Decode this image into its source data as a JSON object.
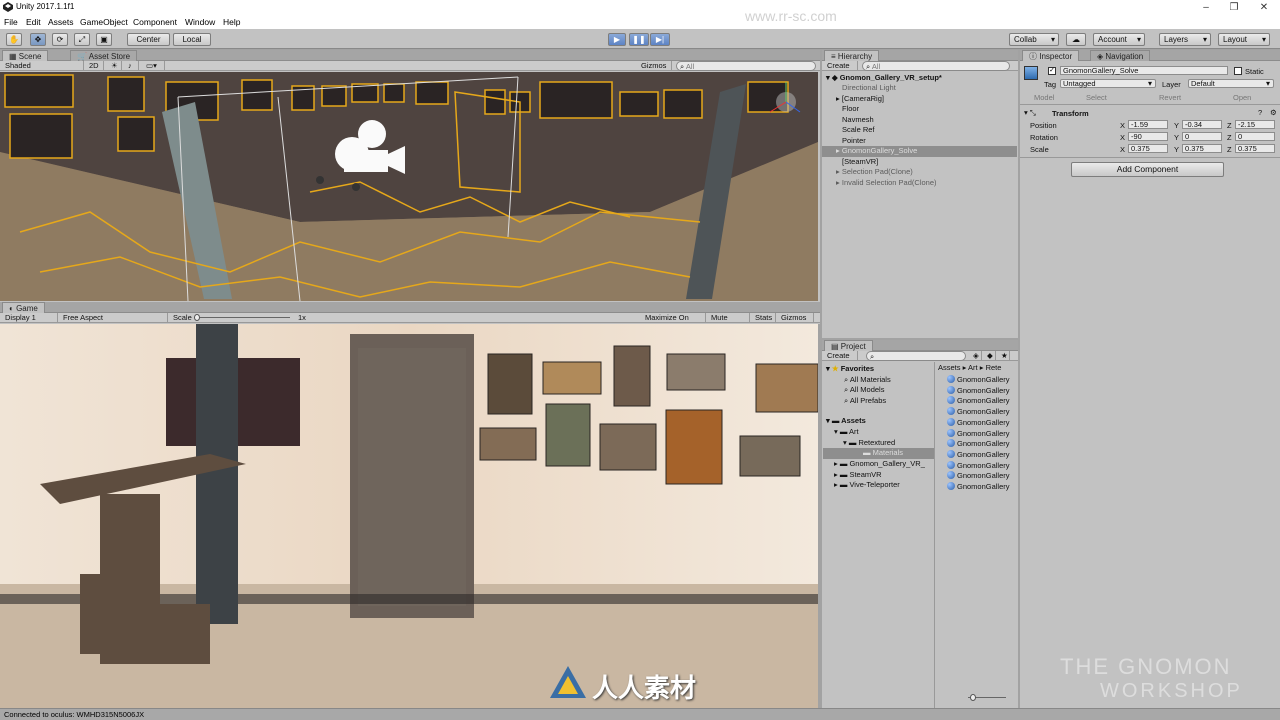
{
  "window": {
    "title": "Unity 2017.1.1f1",
    "min": "–",
    "max": "❐",
    "close": "✕"
  },
  "menu": [
    "File",
    "Edit",
    "Assets",
    "GameObject",
    "Component",
    "Window",
    "Help"
  ],
  "toolbar": {
    "pivot": "Center",
    "space": "Local",
    "collab": "Collab",
    "account": "Account",
    "layers": "Layers",
    "layout": "Layout"
  },
  "scene": {
    "tab_scene": "Scene",
    "tab_store": "Asset Store",
    "shading": "Shaded",
    "mode_2d": "2D",
    "gizmos": "Gizmos",
    "search_placeholder": "All"
  },
  "game": {
    "tab": "Game",
    "display": "Display 1",
    "aspect": "Free Aspect",
    "scale_label": "Scale",
    "scale_value": "1x",
    "maximize": "Maximize On Play",
    "mute": "Mute Audio",
    "stats": "Stats",
    "gizmos": "Gizmos"
  },
  "hierarchy": {
    "tab": "Hierarchy",
    "create": "Create",
    "search_placeholder": "All",
    "scene_name": "Gnomon_Gallery_VR_setup*",
    "items": [
      {
        "label": "Directional Light",
        "state": "gray"
      },
      {
        "label": "[CameraRig]",
        "state": "normal"
      },
      {
        "label": "Floor",
        "state": "normal"
      },
      {
        "label": "Navmesh",
        "state": "normal"
      },
      {
        "label": "Scale Ref",
        "state": "normal"
      },
      {
        "label": "Pointer",
        "state": "normal"
      },
      {
        "label": "GnomonGallery_Solve",
        "state": "selected"
      },
      {
        "label": "[SteamVR]",
        "state": "normal"
      },
      {
        "label": "Selection Pad(Clone)",
        "state": "gray"
      },
      {
        "label": "Invalid Selection Pad(Clone)",
        "state": "gray"
      }
    ]
  },
  "inspector": {
    "tab": "Inspector",
    "tab2": "Navigation",
    "object_name": "GnomonGallery_Solve",
    "static": "Static",
    "tag_label": "Tag",
    "tag_value": "Untagged",
    "layer_label": "Layer",
    "layer_value": "Default",
    "model": "Model",
    "select": "Select",
    "revert": "Revert",
    "open": "Open",
    "transform": "Transform",
    "rows": [
      {
        "label": "Position",
        "x": "-1.59",
        "y": "-0.34",
        "z": "-2.15"
      },
      {
        "label": "Rotation",
        "x": "-90",
        "y": "0",
        "z": "0"
      },
      {
        "label": "Scale",
        "x": "0.375",
        "y": "0.375",
        "z": "0.375"
      }
    ],
    "axis": {
      "x": "X",
      "y": "Y",
      "z": "Z"
    },
    "add_component": "Add Component"
  },
  "project": {
    "tab": "Project",
    "create": "Create",
    "favorites": "Favorites",
    "fav_items": [
      "All Materials",
      "All Models",
      "All Prefabs"
    ],
    "assets": "Assets",
    "art": "Art",
    "retextured": "Retextured",
    "materials": "Materials",
    "others": [
      "Gnomon_Gallery_VR_",
      "SteamVR",
      "Vive-Teleporter"
    ],
    "breadcrumb": [
      "Assets",
      "Art",
      "Rete"
    ],
    "asset_items": [
      "GnomonGallery",
      "GnomonGallery",
      "GnomonGallery",
      "GnomonGallery",
      "GnomonGallery",
      "GnomonGallery",
      "GnomonGallery",
      "GnomonGallery",
      "GnomonGallery",
      "GnomonGallery",
      "GnomonGallery"
    ]
  },
  "status": {
    "text": "Connected to oculus: WMHD315N5006JX"
  },
  "watermark": {
    "logo_text": "人人素材",
    "brand_line1": "THE GNOMON",
    "brand_line2": "WORKSHOP",
    "url": "www.rr-sc.com"
  }
}
